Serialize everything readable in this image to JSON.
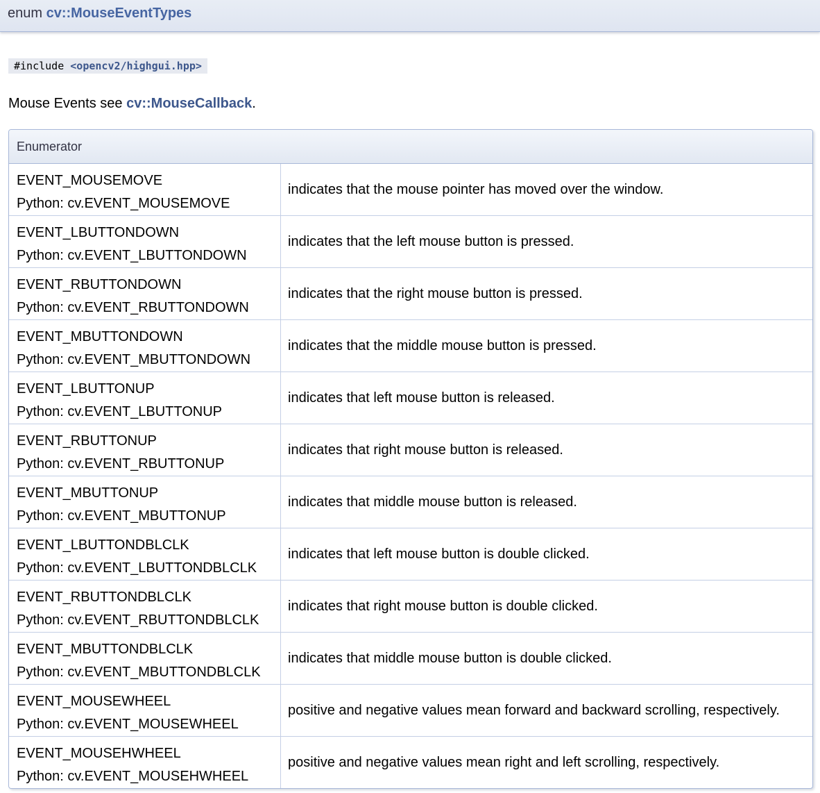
{
  "header": {
    "keyword": "enum",
    "name": "cv::MouseEventTypes"
  },
  "include": {
    "directive": "#include",
    "file": "<opencv2/highgui.hpp>"
  },
  "description": {
    "prefix": "Mouse Events see",
    "link": "cv::MouseCallback",
    "suffix": "."
  },
  "table": {
    "header": "Enumerator",
    "rows": [
      {
        "name": "EVENT_MOUSEMOVE",
        "python": "Python: cv.EVENT_MOUSEMOVE",
        "doc": "indicates that the mouse pointer has moved over the window."
      },
      {
        "name": "EVENT_LBUTTONDOWN",
        "python": "Python: cv.EVENT_LBUTTONDOWN",
        "doc": "indicates that the left mouse button is pressed."
      },
      {
        "name": "EVENT_RBUTTONDOWN",
        "python": "Python: cv.EVENT_RBUTTONDOWN",
        "doc": "indicates that the right mouse button is pressed."
      },
      {
        "name": "EVENT_MBUTTONDOWN",
        "python": "Python: cv.EVENT_MBUTTONDOWN",
        "doc": "indicates that the middle mouse button is pressed."
      },
      {
        "name": "EVENT_LBUTTONUP",
        "python": "Python: cv.EVENT_LBUTTONUP",
        "doc": "indicates that left mouse button is released."
      },
      {
        "name": "EVENT_RBUTTONUP",
        "python": "Python: cv.EVENT_RBUTTONUP",
        "doc": "indicates that right mouse button is released."
      },
      {
        "name": "EVENT_MBUTTONUP",
        "python": "Python: cv.EVENT_MBUTTONUP",
        "doc": "indicates that middle mouse button is released."
      },
      {
        "name": "EVENT_LBUTTONDBLCLK",
        "python": "Python: cv.EVENT_LBUTTONDBLCLK",
        "doc": "indicates that left mouse button is double clicked."
      },
      {
        "name": "EVENT_RBUTTONDBLCLK",
        "python": "Python: cv.EVENT_RBUTTONDBLCLK",
        "doc": "indicates that right mouse button is double clicked."
      },
      {
        "name": "EVENT_MBUTTONDBLCLK",
        "python": "Python: cv.EVENT_MBUTTONDBLCLK",
        "doc": "indicates that middle mouse button is double clicked."
      },
      {
        "name": "EVENT_MOUSEWHEEL",
        "python": "Python: cv.EVENT_MOUSEWHEEL",
        "doc": "positive and negative values mean forward and backward scrolling, respectively."
      },
      {
        "name": "EVENT_MOUSEHWHEEL",
        "python": "Python: cv.EVENT_MOUSEHWHEEL",
        "doc": "positive and negative values mean right and left scrolling, respectively."
      }
    ]
  }
}
